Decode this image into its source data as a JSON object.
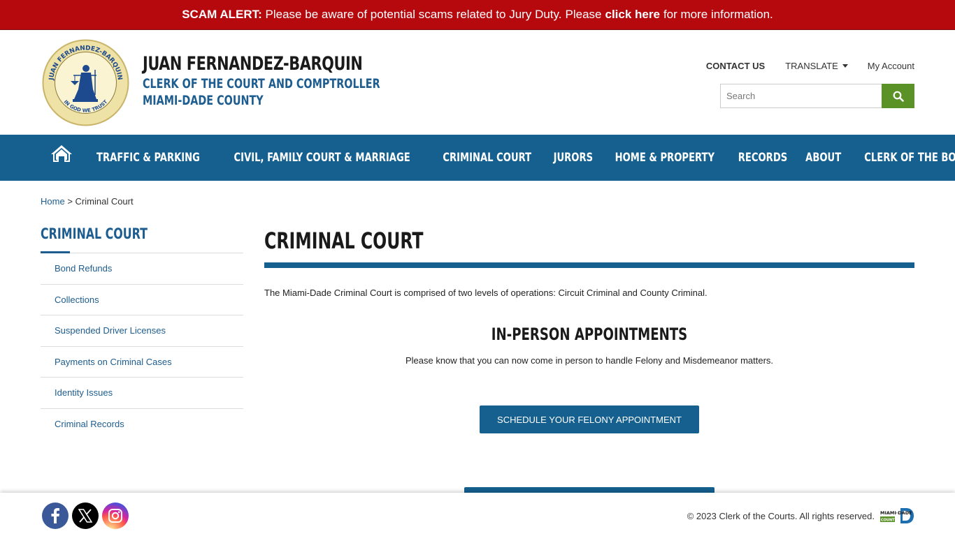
{
  "alert": {
    "prefix": "SCAM ALERT:",
    "text": "Please be aware of potential scams related to Jury Duty.",
    "pre_link": "Please",
    "link": "click here",
    "post_link": "for more information."
  },
  "header": {
    "name": "JUAN FERNANDEZ-BARQUIN",
    "subtitle_1": "CLERK OF THE COURT AND COMPTROLLER",
    "subtitle_2": "MIAMI-DADE COUNTY",
    "seal_top_text": "JUAN FERNANDEZ-BARQUIN",
    "seal_bottom_text": "IN GOD WE TRUST",
    "top_links": {
      "contact": "CONTACT US",
      "translate": "TRANSLATE",
      "account": "My Account"
    },
    "search_placeholder": "Search"
  },
  "nav": {
    "items": [
      "TRAFFIC & PARKING",
      "CIVIL, FAMILY COURT & MARRIAGE",
      "CRIMINAL COURT",
      "JURORS",
      "HOME & PROPERTY",
      "RECORDS",
      "ABOUT",
      "CLERK OF THE BOARD"
    ]
  },
  "breadcrumb": {
    "home": "Home",
    "sep": ">",
    "current": "Criminal Court"
  },
  "sidebar": {
    "title": "CRIMINAL COURT",
    "items": [
      "Bond Refunds",
      "Collections",
      "Suspended Driver Licenses",
      "Payments on Criminal Cases",
      "Identity Issues",
      "Criminal Records"
    ]
  },
  "main": {
    "title": "CRIMINAL COURT",
    "intro": "The Miami-Dade Criminal Court is comprised of two levels of operations: Circuit Criminal and County Criminal.",
    "section_title": "IN-PERSON APPOINTMENTS",
    "section_text": "Please know that you can now come in person to handle Felony and Misdemeanor matters.",
    "cta": "SCHEDULE YOUR FELONY APPOINTMENT"
  },
  "footer": {
    "copyright": "© 2023 Clerk of the Courts. All rights reserved.",
    "social": [
      "facebook-icon",
      "x-twitter-icon",
      "instagram-icon"
    ],
    "logo_text": "MIAMI-DADE COUNTY"
  },
  "colors": {
    "alert": "#b5090e",
    "nav": "#15608f",
    "link": "#1d5d8f",
    "search_button": "#5a9228"
  }
}
